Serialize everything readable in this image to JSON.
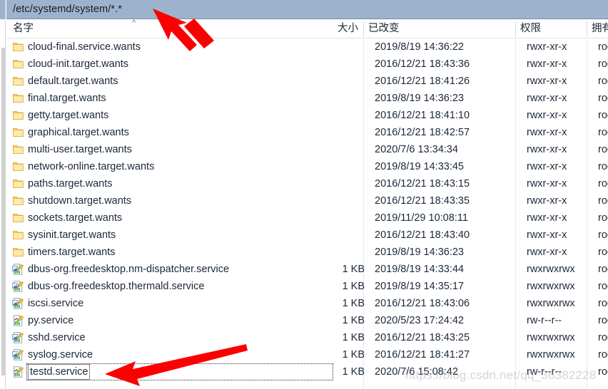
{
  "window": {
    "path_bar_value": "/etc/systemd/system/*.*",
    "sort_indicator": "^"
  },
  "columns": {
    "name": "名字",
    "size": "大小",
    "modified": "已改变",
    "permissions": "权限",
    "owner": "拥有"
  },
  "watermark": "https://blog.csdn.net/qq_36382228",
  "rows": [
    {
      "icon": "folder-icon",
      "name": "cloud-final.service.wants",
      "size": "",
      "modified": "2019/8/19 14:36:22",
      "permissions": "rwxr-xr-x",
      "owner": "roo"
    },
    {
      "icon": "folder-icon",
      "name": "cloud-init.target.wants",
      "size": "",
      "modified": "2016/12/21 18:43:36",
      "permissions": "rwxr-xr-x",
      "owner": "roo"
    },
    {
      "icon": "folder-icon",
      "name": "default.target.wants",
      "size": "",
      "modified": "2016/12/21 18:41:26",
      "permissions": "rwxr-xr-x",
      "owner": "roo"
    },
    {
      "icon": "folder-icon",
      "name": "final.target.wants",
      "size": "",
      "modified": "2019/8/19 14:36:23",
      "permissions": "rwxr-xr-x",
      "owner": "roo"
    },
    {
      "icon": "folder-icon",
      "name": "getty.target.wants",
      "size": "",
      "modified": "2016/12/21 18:41:10",
      "permissions": "rwxr-xr-x",
      "owner": "roo"
    },
    {
      "icon": "folder-icon",
      "name": "graphical.target.wants",
      "size": "",
      "modified": "2016/12/21 18:42:57",
      "permissions": "rwxr-xr-x",
      "owner": "roo"
    },
    {
      "icon": "folder-icon",
      "name": "multi-user.target.wants",
      "size": "",
      "modified": "2020/7/6 13:34:34",
      "permissions": "rwxr-xr-x",
      "owner": "roo"
    },
    {
      "icon": "folder-icon",
      "name": "network-online.target.wants",
      "size": "",
      "modified": "2019/8/19 14:33:45",
      "permissions": "rwxr-xr-x",
      "owner": "roo"
    },
    {
      "icon": "folder-icon",
      "name": "paths.target.wants",
      "size": "",
      "modified": "2016/12/21 18:43:15",
      "permissions": "rwxr-xr-x",
      "owner": "roo"
    },
    {
      "icon": "folder-icon",
      "name": "shutdown.target.wants",
      "size": "",
      "modified": "2016/12/21 18:43:35",
      "permissions": "rwxr-xr-x",
      "owner": "roo"
    },
    {
      "icon": "folder-icon",
      "name": "sockets.target.wants",
      "size": "",
      "modified": "2019/11/29 10:08:11",
      "permissions": "rwxr-xr-x",
      "owner": "roo"
    },
    {
      "icon": "folder-icon",
      "name": "sysinit.target.wants",
      "size": "",
      "modified": "2016/12/21 18:43:40",
      "permissions": "rwxr-xr-x",
      "owner": "roo"
    },
    {
      "icon": "folder-icon",
      "name": "timers.target.wants",
      "size": "",
      "modified": "2019/8/19 14:36:23",
      "permissions": "rwxr-xr-x",
      "owner": "roo"
    },
    {
      "icon": "service-link-icon",
      "name": "dbus-org.freedesktop.nm-dispatcher.service",
      "size": "1 KB",
      "modified": "2019/8/19 14:33:44",
      "permissions": "rwxrwxrwx",
      "owner": "roo"
    },
    {
      "icon": "service-link-icon",
      "name": "dbus-org.freedesktop.thermald.service",
      "size": "1 KB",
      "modified": "2019/8/19 14:35:17",
      "permissions": "rwxrwxrwx",
      "owner": "roo"
    },
    {
      "icon": "service-link-icon",
      "name": "iscsi.service",
      "size": "1 KB",
      "modified": "2016/12/21 18:43:06",
      "permissions": "rwxrwxrwx",
      "owner": "roo"
    },
    {
      "icon": "service-file-icon",
      "name": "py.service",
      "size": "1 KB",
      "modified": "2020/5/23 17:24:42",
      "permissions": "rw-r--r--",
      "owner": "roo"
    },
    {
      "icon": "service-link-icon",
      "name": "sshd.service",
      "size": "1 KB",
      "modified": "2016/12/21 18:43:25",
      "permissions": "rwxrwxrwx",
      "owner": "roo"
    },
    {
      "icon": "service-link-icon",
      "name": "syslog.service",
      "size": "1 KB",
      "modified": "2016/12/21 18:41:27",
      "permissions": "rwxrwxrwx",
      "owner": "roo"
    },
    {
      "icon": "service-file-icon",
      "name": "testd.service",
      "size": "1 KB",
      "modified": "2020/7/6 15:08:42",
      "permissions": "rw-r--r--",
      "owner": "roo",
      "focused": true
    }
  ],
  "annotations": {
    "arrow_color": "#fb0000",
    "arrow_to_pathbar": "points to path bar value",
    "arrow_to_testd": "points to testd.service row"
  }
}
